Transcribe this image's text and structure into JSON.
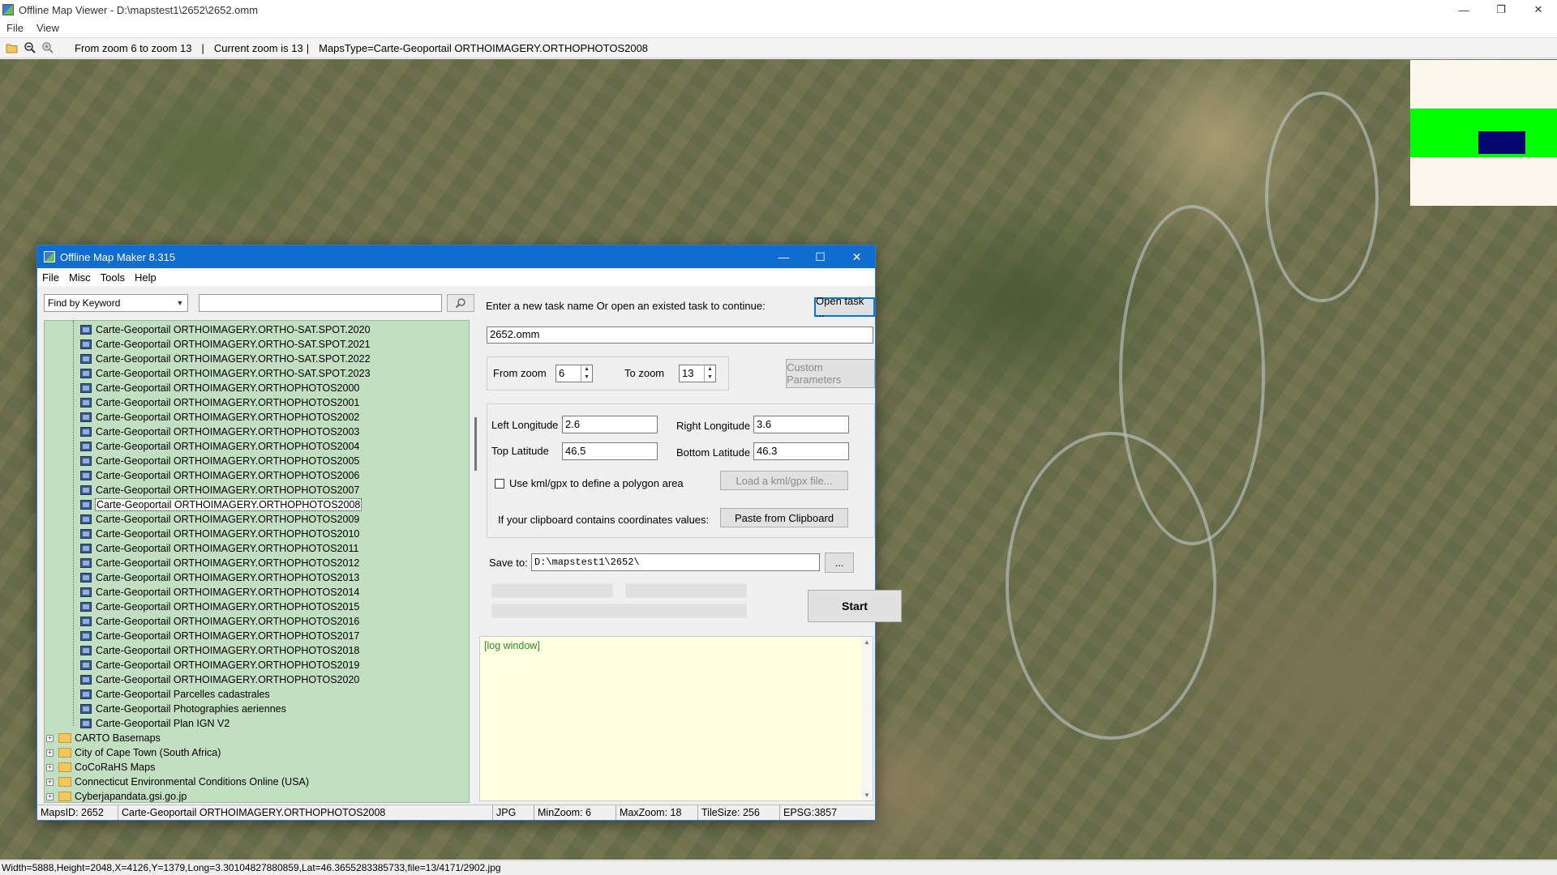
{
  "window": {
    "title": "Offline Map Viewer - D:\\mapstest1\\2652\\2652.omm",
    "controls": {
      "minimize": "—",
      "maximize": "❐",
      "close": "✕"
    }
  },
  "menu": {
    "file": "File",
    "view": "View"
  },
  "toolbar": {
    "zoom_range": "From zoom 6 to zoom 13",
    "sep1": "|",
    "current_zoom": "Current zoom is 13",
    "sep2": "|",
    "maps_type": "MapsType=Carte-Geoportail ORTHOIMAGERY.ORTHOPHOTOS2008"
  },
  "minimap": {
    "colors": {
      "background": "#fbf7ec",
      "band": "#00ff00",
      "view": "#00066e"
    }
  },
  "statusbar": {
    "text": "Width=5888,Height=2048,X=4126,Y=1379,Long=3.30104827880859,Lat=46.3655283385733,file=13/4171/2902.jpg"
  },
  "dialog": {
    "title": "Offline Map Maker 8.315",
    "controls": {
      "minimize": "—",
      "maximize": "☐",
      "close": "✕"
    },
    "menu": {
      "file": "File",
      "misc": "Misc",
      "tools": "Tools",
      "help": "Help"
    },
    "find": {
      "mode": "Find by Keyword",
      "value": "",
      "search_icon": "magnifier-icon"
    },
    "tree": {
      "items": [
        "Carte-Geoportail ORTHOIMAGERY.ORTHO-SAT.SPOT.2020",
        "Carte-Geoportail ORTHOIMAGERY.ORTHO-SAT.SPOT.2021",
        "Carte-Geoportail ORTHOIMAGERY.ORTHO-SAT.SPOT.2022",
        "Carte-Geoportail ORTHOIMAGERY.ORTHO-SAT.SPOT.2023",
        "Carte-Geoportail ORTHOIMAGERY.ORTHOPHOTOS2000",
        "Carte-Geoportail ORTHOIMAGERY.ORTHOPHOTOS2001",
        "Carte-Geoportail ORTHOIMAGERY.ORTHOPHOTOS2002",
        "Carte-Geoportail ORTHOIMAGERY.ORTHOPHOTOS2003",
        "Carte-Geoportail ORTHOIMAGERY.ORTHOPHOTOS2004",
        "Carte-Geoportail ORTHOIMAGERY.ORTHOPHOTOS2005",
        "Carte-Geoportail ORTHOIMAGERY.ORTHOPHOTOS2006",
        "Carte-Geoportail ORTHOIMAGERY.ORTHOPHOTOS2007",
        "Carte-Geoportail ORTHOIMAGERY.ORTHOPHOTOS2008",
        "Carte-Geoportail ORTHOIMAGERY.ORTHOPHOTOS2009",
        "Carte-Geoportail ORTHOIMAGERY.ORTHOPHOTOS2010",
        "Carte-Geoportail ORTHOIMAGERY.ORTHOPHOTOS2011",
        "Carte-Geoportail ORTHOIMAGERY.ORTHOPHOTOS2012",
        "Carte-Geoportail ORTHOIMAGERY.ORTHOPHOTOS2013",
        "Carte-Geoportail ORTHOIMAGERY.ORTHOPHOTOS2014",
        "Carte-Geoportail ORTHOIMAGERY.ORTHOPHOTOS2015",
        "Carte-Geoportail ORTHOIMAGERY.ORTHOPHOTOS2016",
        "Carte-Geoportail ORTHOIMAGERY.ORTHOPHOTOS2017",
        "Carte-Geoportail ORTHOIMAGERY.ORTHOPHOTOS2018",
        "Carte-Geoportail ORTHOIMAGERY.ORTHOPHOTOS2019",
        "Carte-Geoportail ORTHOIMAGERY.ORTHOPHOTOS2020",
        "Carte-Geoportail Parcelles cadastrales",
        "Carte-Geoportail Photographies aeriennes",
        "Carte-Geoportail Plan IGN V2"
      ],
      "selected": "Carte-Geoportail ORTHOIMAGERY.ORTHOPHOTOS2008",
      "folders": [
        "CARTO Basemaps",
        "City of Cape Town (South Africa)",
        "CoCoRaHS Maps",
        "Connecticut Environmental Conditions Online (USA)",
        "Cyberjapandata.gsi.go.jp"
      ]
    },
    "task": {
      "prompt": "Enter a new task name Or open an existed task to continue:",
      "open_button": "Open task ...",
      "name": "2652.omm"
    },
    "zoom": {
      "from_label": "From zoom",
      "from_value": "6",
      "to_label": "To zoom",
      "to_value": "13",
      "custom_button": "Custom Parameters"
    },
    "coords": {
      "left_lon_label": "Left Longitude",
      "left_lon": "2.6",
      "right_lon_label": "Right Longitude",
      "right_lon": "3.6",
      "top_lat_label": "Top Latitude",
      "top_lat": "46.5",
      "bottom_lat_label": "Bottom Latitude",
      "bottom_lat": "46.3",
      "kml_label": "Use kml/gpx to define a polygon area",
      "kml_checked": false,
      "kml_button": "Load a kml/gpx file...",
      "clipboard_label": "If your clipboard contains coordinates values:",
      "clipboard_button": "Paste from Clipboard"
    },
    "save": {
      "label": "Save to:",
      "path": "D:\\mapstest1\\2652\\",
      "browse_button": "..."
    },
    "start_button": "Start",
    "log": {
      "text": "[log window]"
    },
    "status": {
      "maps_id": "MapsID: 2652",
      "map_name": "Carte-Geoportail ORTHOIMAGERY.ORTHOPHOTOS2008",
      "format": "JPG",
      "min_zoom": "MinZoom: 6",
      "max_zoom": "MaxZoom: 18",
      "tile_size": "TileSize: 256",
      "epsg": "EPSG:3857"
    }
  }
}
